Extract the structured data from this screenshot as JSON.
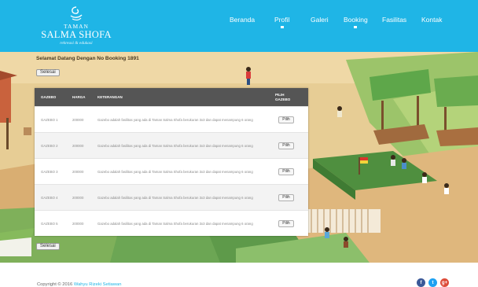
{
  "brand": {
    "line1": "TAMAN",
    "line2": "SALMA SHOFA",
    "line3": "rekreasi & edukasi"
  },
  "nav": {
    "items": [
      {
        "label": "Beranda"
      },
      {
        "label": "Profil"
      },
      {
        "label": "Galeri"
      },
      {
        "label": "Booking"
      },
      {
        "label": "Fasilitas"
      },
      {
        "label": "Kontak"
      }
    ]
  },
  "welcome_text": "Selamat Datang Dengan No Booking 1891",
  "buttons": {
    "selesai_top": "Selesai",
    "selesai_bottom": "Selesai",
    "pilih": "Pilih"
  },
  "table": {
    "headers": [
      "GAZEBO",
      "HARGA",
      "KETERANGAN",
      "PILIH GAZEBO"
    ],
    "rows": [
      {
        "gazebo": "GAZEBO 1",
        "harga": "200000",
        "keterangan": "Gazebo adalah fasilitas yang ada di Taman Salma Shofa berukuran 3x3 dan dapat menampung 6 orang"
      },
      {
        "gazebo": "GAZEBO 2",
        "harga": "200000",
        "keterangan": "Gazebo adalah fasilitas yang ada di Taman Salma Shofa berukuran 3x3 dan dapat menampung 6 orang"
      },
      {
        "gazebo": "GAZEBO 3",
        "harga": "200000",
        "keterangan": "Gazebo adalah fasilitas yang ada di Taman Salma Shofa berukuran 3x3 dan dapat menampung 6 orang"
      },
      {
        "gazebo": "GAZEBO 4",
        "harga": "200000",
        "keterangan": "Gazebo adalah fasilitas yang ada di Taman Salma Shofa berukuran 3x3 dan dapat menampung 6 orang"
      },
      {
        "gazebo": "GAZEBO 5",
        "harga": "200000",
        "keterangan": "Gazebo adalah fasilitas yang ada di Taman Salma Shofa berukuran 3x3 dan dapat menampung 6 orang"
      }
    ]
  },
  "footer": {
    "copyright_prefix": "Copyright © 2016",
    "author": "Wahyu Rizeki Setiawan"
  },
  "social": [
    {
      "icon": "facebook-icon",
      "glyph": "f",
      "color": "#3b5998"
    },
    {
      "icon": "twitter-icon",
      "glyph": "t",
      "color": "#1da1f2"
    },
    {
      "icon": "google-plus-icon",
      "glyph": "g+",
      "color": "#dd4b39"
    }
  ],
  "colors": {
    "header": "#1fb5e6",
    "table_header": "#555555"
  }
}
